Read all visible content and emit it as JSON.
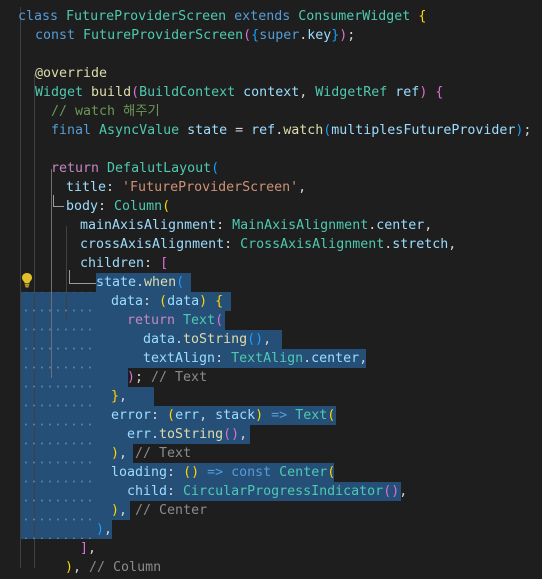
{
  "colors": {
    "background": "#1e1e1e",
    "selection": "#264f78",
    "keyword": "#569cd6",
    "control": "#c586c0",
    "type": "#4ec9b0",
    "function": "#dcdcaa",
    "variable": "#9cdcfe",
    "string": "#ce9178",
    "comment": "#6a9955",
    "plain": "#d4d4d4",
    "bracket_gold": "#ffd700",
    "bracket_pink": "#da70d6",
    "bracket_blue": "#179fff",
    "inlay_hint": "#8b8b8b"
  },
  "lightbulb_icon": "lightbulb-icon",
  "code_lines": [
    [
      [
        "class ",
        "keyword"
      ],
      [
        "FutureProviderScreen ",
        "type"
      ],
      [
        "extends ",
        "keyword"
      ],
      [
        "ConsumerWidget ",
        "type"
      ],
      [
        "{",
        "bracket_gold"
      ]
    ],
    [
      [
        "const ",
        "keyword"
      ],
      [
        "FutureProviderScreen",
        "type"
      ],
      [
        "(",
        "bracket_pink"
      ],
      [
        "{",
        "bracket_blue"
      ],
      [
        "super",
        "keyword"
      ],
      [
        ".",
        "plain"
      ],
      [
        "key",
        "variable"
      ],
      [
        "}",
        "bracket_blue"
      ],
      [
        ")",
        "bracket_pink"
      ],
      [
        ";",
        "plain"
      ]
    ],
    [],
    [
      [
        "@override",
        "function"
      ]
    ],
    [
      [
        "Widget ",
        "type"
      ],
      [
        "build",
        "function"
      ],
      [
        "(",
        "bracket_pink"
      ],
      [
        "BuildContext ",
        "type"
      ],
      [
        "context",
        "variable"
      ],
      [
        ", ",
        "plain"
      ],
      [
        "WidgetRef ",
        "type"
      ],
      [
        "ref",
        "variable"
      ],
      [
        ") ",
        "bracket_pink"
      ],
      [
        "{",
        "bracket_pink"
      ]
    ],
    [
      [
        "// watch 해주기",
        "comment"
      ]
    ],
    [
      [
        "final ",
        "keyword"
      ],
      [
        "AsyncValue ",
        "type"
      ],
      [
        "state ",
        "variable"
      ],
      [
        "= ",
        "plain"
      ],
      [
        "ref",
        "variable"
      ],
      [
        ".",
        "plain"
      ],
      [
        "watch",
        "function"
      ],
      [
        "(",
        "bracket_blue"
      ],
      [
        "multiplesFutureProvider",
        "variable"
      ],
      [
        ")",
        "bracket_blue"
      ],
      [
        ";",
        "plain"
      ]
    ],
    [],
    [
      [
        "return ",
        "control"
      ],
      [
        "DefalutLayout",
        "type"
      ],
      [
        "(",
        "bracket_blue"
      ]
    ],
    [
      [
        "title",
        "variable"
      ],
      [
        ": ",
        "plain"
      ],
      [
        "'FutureProviderScreen'",
        "string"
      ],
      [
        ",",
        "plain"
      ]
    ],
    [
      [
        "body",
        "variable"
      ],
      [
        ": ",
        "plain"
      ],
      [
        "Column",
        "type"
      ],
      [
        "(",
        "bracket_gold"
      ]
    ],
    [
      [
        "mainAxisAlignment",
        "variable"
      ],
      [
        ": ",
        "plain"
      ],
      [
        "MainAxisAlignment",
        "type"
      ],
      [
        ".",
        "plain"
      ],
      [
        "center",
        "variable"
      ],
      [
        ",",
        "plain"
      ]
    ],
    [
      [
        "crossAxisAlignment",
        "variable"
      ],
      [
        ": ",
        "plain"
      ],
      [
        "CrossAxisAlignment",
        "type"
      ],
      [
        ".",
        "plain"
      ],
      [
        "stretch",
        "variable"
      ],
      [
        ",",
        "plain"
      ]
    ],
    [
      [
        "children",
        "variable"
      ],
      [
        ": ",
        "plain"
      ],
      [
        "[",
        "bracket_pink"
      ]
    ],
    [
      [
        "state",
        "variable"
      ],
      [
        ".",
        "plain"
      ],
      [
        "when",
        "function"
      ],
      [
        "(",
        "bracket_blue"
      ]
    ],
    [
      [
        "data",
        "variable"
      ],
      [
        ": ",
        "plain"
      ],
      [
        "(",
        "bracket_gold"
      ],
      [
        "data",
        "variable"
      ],
      [
        ") ",
        "bracket_gold"
      ],
      [
        "{",
        "bracket_gold"
      ]
    ],
    [
      [
        "return ",
        "control"
      ],
      [
        "Text",
        "type"
      ],
      [
        "(",
        "bracket_pink"
      ]
    ],
    [
      [
        "data",
        "variable"
      ],
      [
        ".",
        "plain"
      ],
      [
        "toString",
        "function"
      ],
      [
        "()",
        "bracket_blue"
      ],
      [
        ",",
        "plain"
      ]
    ],
    [
      [
        "textAlign",
        "variable"
      ],
      [
        ": ",
        "plain"
      ],
      [
        "TextAlign",
        "type"
      ],
      [
        ".",
        "plain"
      ],
      [
        "center",
        "variable"
      ],
      [
        ",",
        "plain"
      ]
    ],
    [
      [
        ")",
        "bracket_pink"
      ],
      [
        "; ",
        "plain"
      ],
      [
        "// Text",
        "inlay_hint"
      ]
    ],
    [
      [
        "}",
        "bracket_gold"
      ],
      [
        ",",
        "plain"
      ]
    ],
    [
      [
        "error",
        "variable"
      ],
      [
        ": ",
        "plain"
      ],
      [
        "(",
        "bracket_gold"
      ],
      [
        "err",
        "variable"
      ],
      [
        ", ",
        "plain"
      ],
      [
        "stack",
        "variable"
      ],
      [
        ") ",
        "bracket_gold"
      ],
      [
        "=> ",
        "keyword"
      ],
      [
        "Text",
        "type"
      ],
      [
        "(",
        "bracket_gold"
      ]
    ],
    [
      [
        "err",
        "variable"
      ],
      [
        ".",
        "plain"
      ],
      [
        "toString",
        "function"
      ],
      [
        "()",
        "bracket_pink"
      ],
      [
        ",",
        "plain"
      ]
    ],
    [
      [
        ")",
        "bracket_gold"
      ],
      [
        ", ",
        "plain"
      ],
      [
        "// Text",
        "inlay_hint"
      ]
    ],
    [
      [
        "loading",
        "variable"
      ],
      [
        ": ",
        "plain"
      ],
      [
        "() ",
        "bracket_gold"
      ],
      [
        "=> ",
        "keyword"
      ],
      [
        "const ",
        "keyword"
      ],
      [
        "Center",
        "type"
      ],
      [
        "(",
        "bracket_gold"
      ]
    ],
    [
      [
        "child",
        "variable"
      ],
      [
        ": ",
        "plain"
      ],
      [
        "CircularProgressIndicator",
        "type"
      ],
      [
        "()",
        "bracket_pink"
      ],
      [
        ",",
        "plain"
      ]
    ],
    [
      [
        ")",
        "bracket_gold"
      ],
      [
        ", ",
        "plain"
      ],
      [
        "// Center",
        "inlay_hint"
      ]
    ],
    [
      [
        ")",
        "bracket_blue"
      ],
      [
        ",",
        "plain"
      ]
    ],
    [
      [
        "]",
        "bracket_pink"
      ],
      [
        ",",
        "plain"
      ]
    ],
    [
      [
        ")",
        "bracket_gold"
      ],
      [
        ", ",
        "plain"
      ],
      [
        "// Column",
        "inlay_hint"
      ]
    ]
  ]
}
